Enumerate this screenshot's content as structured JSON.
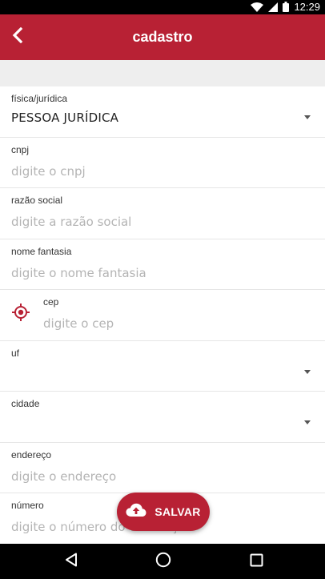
{
  "status_bar": {
    "time": "12:29",
    "icons": [
      "wifi-icon",
      "signal-icon",
      "battery-icon"
    ]
  },
  "app_bar": {
    "title": "cadastro",
    "back_icon": "back-arrow-icon"
  },
  "form": {
    "person_type": {
      "label": "física/jurídica",
      "value": "PESSOA JURÍDICA"
    },
    "cnpj": {
      "label": "cnpj",
      "value": "",
      "placeholder": "digite o cnpj"
    },
    "razao_social": {
      "label": "razão social",
      "value": "",
      "placeholder": "digite a razão social"
    },
    "nome_fantasia": {
      "label": "nome fantasia",
      "value": "",
      "placeholder": "digite o nome fantasia"
    },
    "cep": {
      "label": "cep",
      "value": "",
      "placeholder": "digite o cep",
      "icon": "location-target-icon"
    },
    "uf": {
      "label": "uf",
      "value": ""
    },
    "cidade": {
      "label": "cidade",
      "value": ""
    },
    "endereco": {
      "label": "endereço",
      "value": "",
      "placeholder": "digite o endereço"
    },
    "numero": {
      "label": "número",
      "value": "",
      "placeholder": "digite o número do endereço"
    }
  },
  "fab": {
    "label": "SALVAR",
    "icon": "cloud-upload-icon"
  },
  "nav_bar": {
    "icons": [
      "nav-back-icon",
      "nav-home-icon",
      "nav-recents-icon"
    ]
  },
  "colors": {
    "primary": "#b82134",
    "band": "#eeeeee",
    "placeholder": "#b4b4b4",
    "divider": "#e6e6e6"
  }
}
